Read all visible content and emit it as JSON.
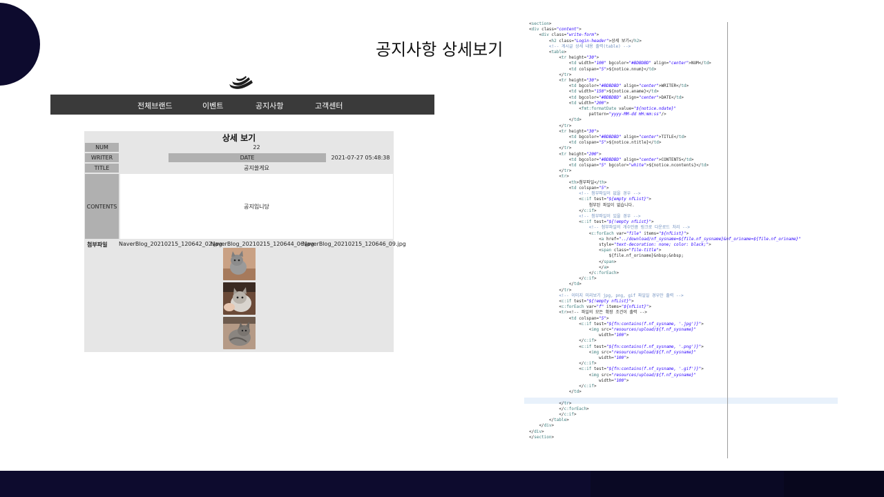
{
  "slide": {
    "title": "공지사항 상세보기"
  },
  "nav": {
    "items": [
      "전체브랜드",
      "이벤트",
      "공지사항",
      "고객센터"
    ]
  },
  "detail": {
    "heading": "상세 보기",
    "num_label": "NUM",
    "num_value": "22",
    "writer_label": "WRITER",
    "date_label": "DATE",
    "date_value": "2021-07-27 05:48:38",
    "title_label": "TITLE",
    "title_value": "공지쓸게요",
    "contents_label": "CONTENTS",
    "contents_value": "공지입니당",
    "attach_label": "첨부파일",
    "files": [
      "NaverBlog_20210215_120642_02.jpg",
      "NaverBlog_20210215_120644_06.jpg",
      "NaverBlog_20210215_120646_09.jpg"
    ]
  },
  "code_lines": [
    "<section>",
    "<div class=\"content\">",
    "    <div class=\"write-form\">",
    "        <h2 class=\"Login-header\">상세 보기</h2>",
    "        <!-- 게시글 상세 내용 출력(table) -->",
    "        <table>",
    "            <tr height=\"30\">",
    "                <td width=\"100\" bgcolor=\"#BDBDBD\" align=\"center\">NUM</td>",
    "                <td colspan=\"5\">${notice.nnum}</td>",
    "            </tr>",
    "            <tr height=\"30\">",
    "                <td bgcolor=\"#BDBDBD\" align=\"center\">WRITER</td>",
    "                <td width=\"150\">${notice.aname}</td>",
    "                <td bgcolor=\"#BDBDBD\" align=\"center\">DATE</td>",
    "                <td width=\"200\">",
    "                    <fmt:formatDate value=\"${notice.ndate}\"",
    "                        pattern=\"yyyy-MM-dd HH:mm:ss\"/>",
    "                </td>",
    "            </tr>",
    "            <tr height=\"30\">",
    "                <td bgcolor=\"#BDBDBD\" align=\"center\">TITLE</td>",
    "                <td colspan=\"5\">${notice.ntitle}</td>",
    "            </tr>",
    "            <tr height=\"200\">",
    "                <td bgcolor=\"#BDBDBD\" align=\"center\">CONTENTS</td>",
    "                <td colspan=\"5\" bgcolor=\"white\">${notice.ncontents}</td>",
    "            </tr>",
    "            <tr>",
    "                <th>첨부파일</th>",
    "                <td colspan=\"5\">",
    "                    <!-- 첨부파일이 없을 경우 -->",
    "                    <c:if test=\"${empty nfList}\">",
    "                        첨부된 파일이 없습니다.",
    "                    </c:if>",
    "                    <!-- 첨부파일이 있을 경우 -->",
    "                    <c:if test=\"${!empty nfList}\">",
    "                        <!-- 첨부파일의 개수만큼 링크로 다운로드 처리 -->",
    "                        <c:forEach var=\"file\" items=\"${nfList}\">",
    "                            <a href=\"../download/nf_sysname=${file.nf_sysname}&nf_oriname=${file.nf_oriname}\"",
    "                            style=\"text-decoration: none; color: black;\">",
    "                            <span class=\"file-title\">",
    "                                ${file.nf_oriname}&nbsp;&nbsp;",
    "                            </span>",
    "                            </a>",
    "                        </c:forEach>",
    "                    </c:if>",
    "                </td>",
    "            </tr>",
    "            <!-- 이미지 미리보기 jpg, png, gif 파일일 경우만 출력 -->",
    "            <c:if test=\"${!empty nfList}\">",
    "            <c:forEach var=\"f\" items=\"${nfList}\">",
    "            <tr><!-- 파일의 모든 확장 조건이 출력 -->",
    "                <td colspan=\"5\">",
    "                    <c:if test=\"${fn:contains(f.nf_sysname, '.jpg')}\">",
    "                        <img src=\"resources/upload/${f.nf_sysname}\"",
    "                            width=\"100\">",
    "                    </c:if>",
    "                    <c:if test=\"${fn:contains(f.nf_sysname, '.png')}\">",
    "                        <img src=\"resources/upload/${f.nf_sysname}\"",
    "                            width=\"100\">",
    "                    </c:if>",
    "                    <c:if test=\"${fn:contains(f.nf_sysname, '.gif')}\">",
    "                        <img src=\"resources/upload/${f.nf_sysname}\"",
    "                            width=\"100\">",
    "                    </c:if>",
    "                </td>",
    "",
    "            </tr>",
    "            </c:forEach>",
    "            </c:if>",
    "        </table>",
    "    </div>",
    "</div>",
    "</section>"
  ]
}
